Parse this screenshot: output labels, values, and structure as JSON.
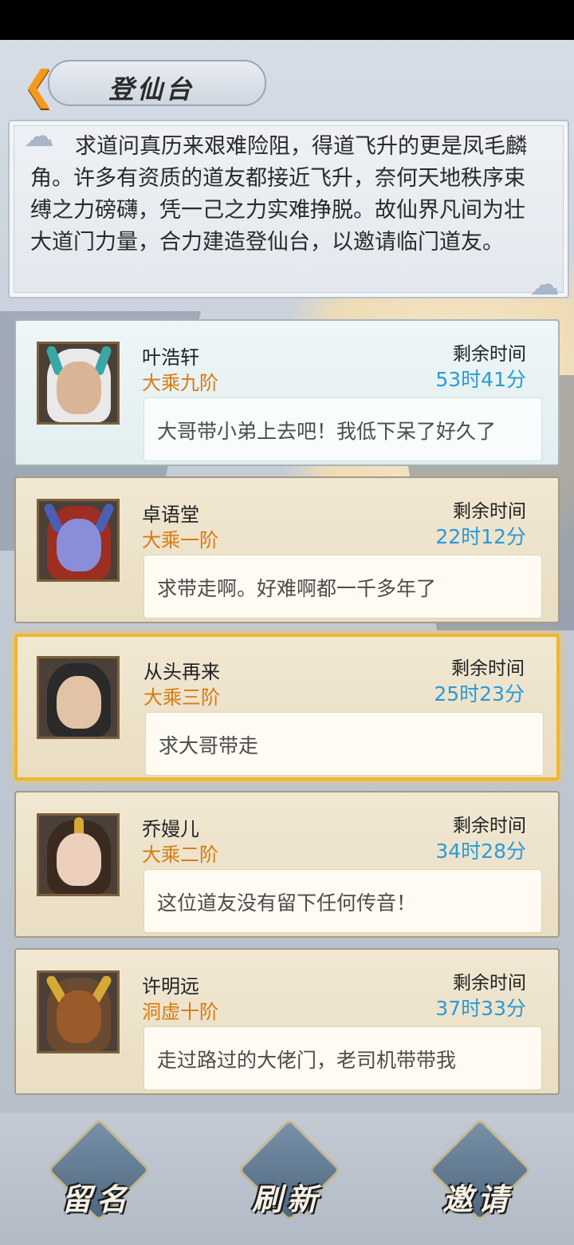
{
  "header": {
    "back_icon": "chevron-left-icon",
    "title": "登仙台"
  },
  "description": "求道问真历来艰难险阻，得道飞升的更是凤毛麟角。许多有资质的道友都接近飞升，奈何天地秩序束缚之力磅礴，凭一己之力实难挣脱。故仙界凡间为壮大道门力量，合力建造登仙台，以邀请临门道友。",
  "entries": [
    {
      "name": "叶浩轩",
      "rank": "大乘九阶",
      "time_label": "剩余时间",
      "time_left": "53时41分",
      "message": "大哥带小弟上去吧！我低下呆了好久了"
    },
    {
      "name": "卓语堂",
      "rank": "大乘一阶",
      "time_label": "剩余时间",
      "time_left": "22时12分",
      "message": "求带走啊。好难啊都一千多年了"
    },
    {
      "name": "从头再来",
      "rank": "大乘三阶",
      "time_label": "剩余时间",
      "time_left": "25时23分",
      "message": "求大哥带走"
    },
    {
      "name": "乔嫚儿",
      "rank": "大乘二阶",
      "time_label": "剩余时间",
      "time_left": "34时28分",
      "message": "这位道友没有留下任何传音！"
    },
    {
      "name": "许明远",
      "rank": "洞虚十阶",
      "time_label": "剩余时间",
      "time_left": "37时33分",
      "message": "走过路过的大佬门，老司机带带我"
    }
  ],
  "bottom_buttons": {
    "leave_name": "留名",
    "refresh": "刷新",
    "invite": "邀请"
  },
  "colors": {
    "accent_orange": "#f39a1c",
    "rank_orange": "#d77a12",
    "time_blue": "#2a9ad8",
    "selected_border": "#f2b52b"
  }
}
